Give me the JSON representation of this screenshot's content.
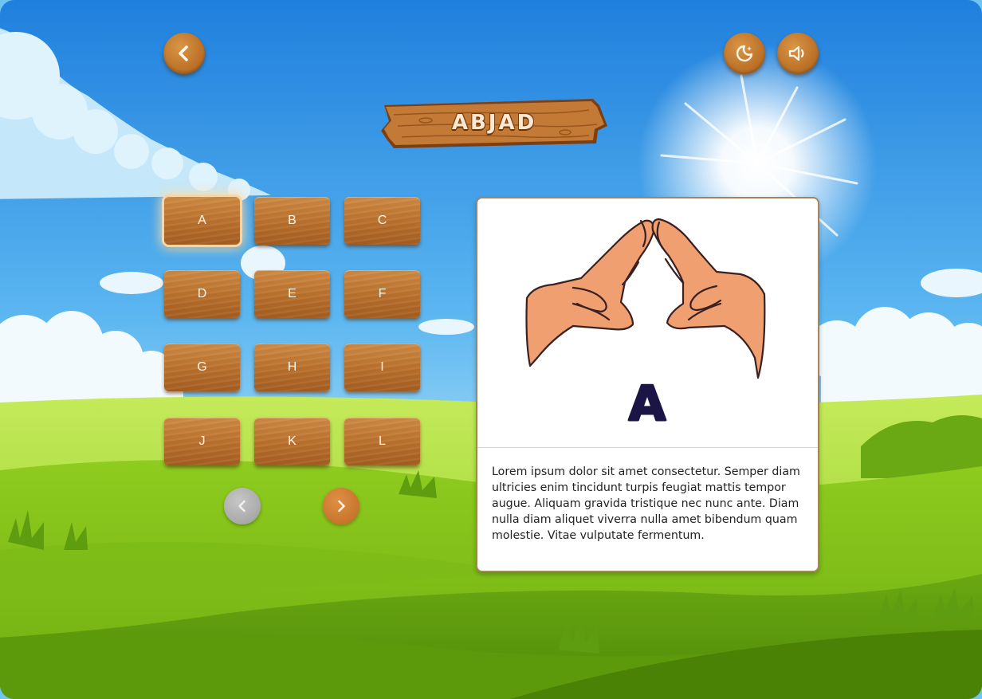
{
  "title": "ABJAD",
  "header": {
    "back_icon": "chevron-left-icon",
    "night_mode_icon": "moon-stars-icon",
    "sound_icon": "speaker-icon"
  },
  "letters": [
    "A",
    "B",
    "C",
    "D",
    "E",
    "F",
    "G",
    "H",
    "I",
    "J",
    "K",
    "L"
  ],
  "selected_letter": "A",
  "pagination": {
    "prev_icon": "chevron-left-icon",
    "next_icon": "chevron-right-icon",
    "prev_enabled": false,
    "next_enabled": true
  },
  "detail": {
    "letter": "A",
    "image_icon": "hand-sign-a-icon",
    "description": "Lorem ipsum dolor sit amet consectetur. Semper diam ultricies enim tincidunt turpis feugiat mattis tempor augue. Aliquam gravida tristique nec nunc ante. Diam nulla diam aliquet viverra nulla amet bibendum quam molestie. Vitae vulputate fermentum."
  },
  "colors": {
    "wood": "#b96f2c",
    "wood_light": "#cf8a43",
    "disabled": "#a8a8a8",
    "sky": "#3a9be4",
    "grass": "#7bbd1e",
    "letter_ink": "#1b1546",
    "skin": "#f0a070"
  }
}
